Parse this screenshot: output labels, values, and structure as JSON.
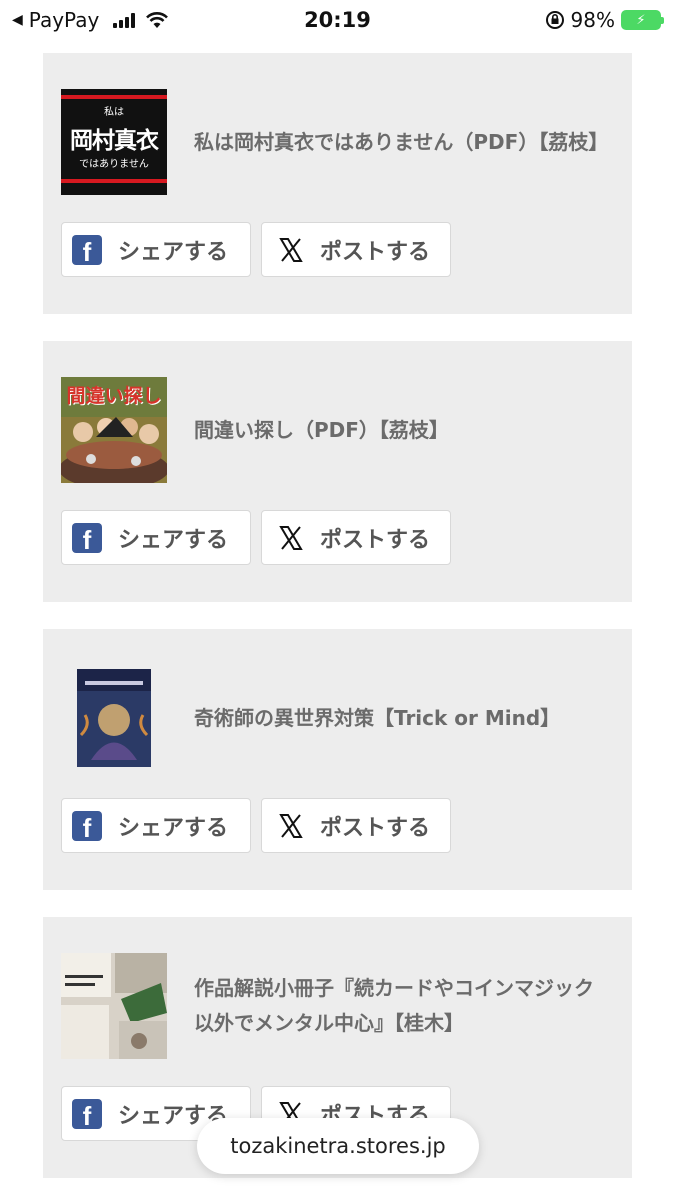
{
  "status_bar": {
    "back_label": "PayPay",
    "time": "20:19",
    "battery_percent": "98%",
    "battery_level": 0.98
  },
  "products": [
    {
      "title": "私は岡村真衣ではありません（PDF）【茘枝】",
      "thumb_text_small": "私は",
      "thumb_text_big": "岡村真衣",
      "thumb_text_sub": "ではありません"
    },
    {
      "title": "間違い探し（PDF）【茘枝】",
      "thumb_text_top": "間違い探し"
    },
    {
      "title": "奇術師の異世界対策【Trick or Mind】"
    },
    {
      "title": "作品解説小冊子『続カードやコインマジック以外でメンタル中心』【桂木】"
    }
  ],
  "share": {
    "facebook_label": "シェアする",
    "x_label": "ポストする"
  },
  "url_bar": {
    "url": "tozakinetra.stores.jp"
  },
  "colors": {
    "facebook": "#3b5998",
    "card_bg": "#ededed",
    "title_text": "#6b6b6b"
  }
}
